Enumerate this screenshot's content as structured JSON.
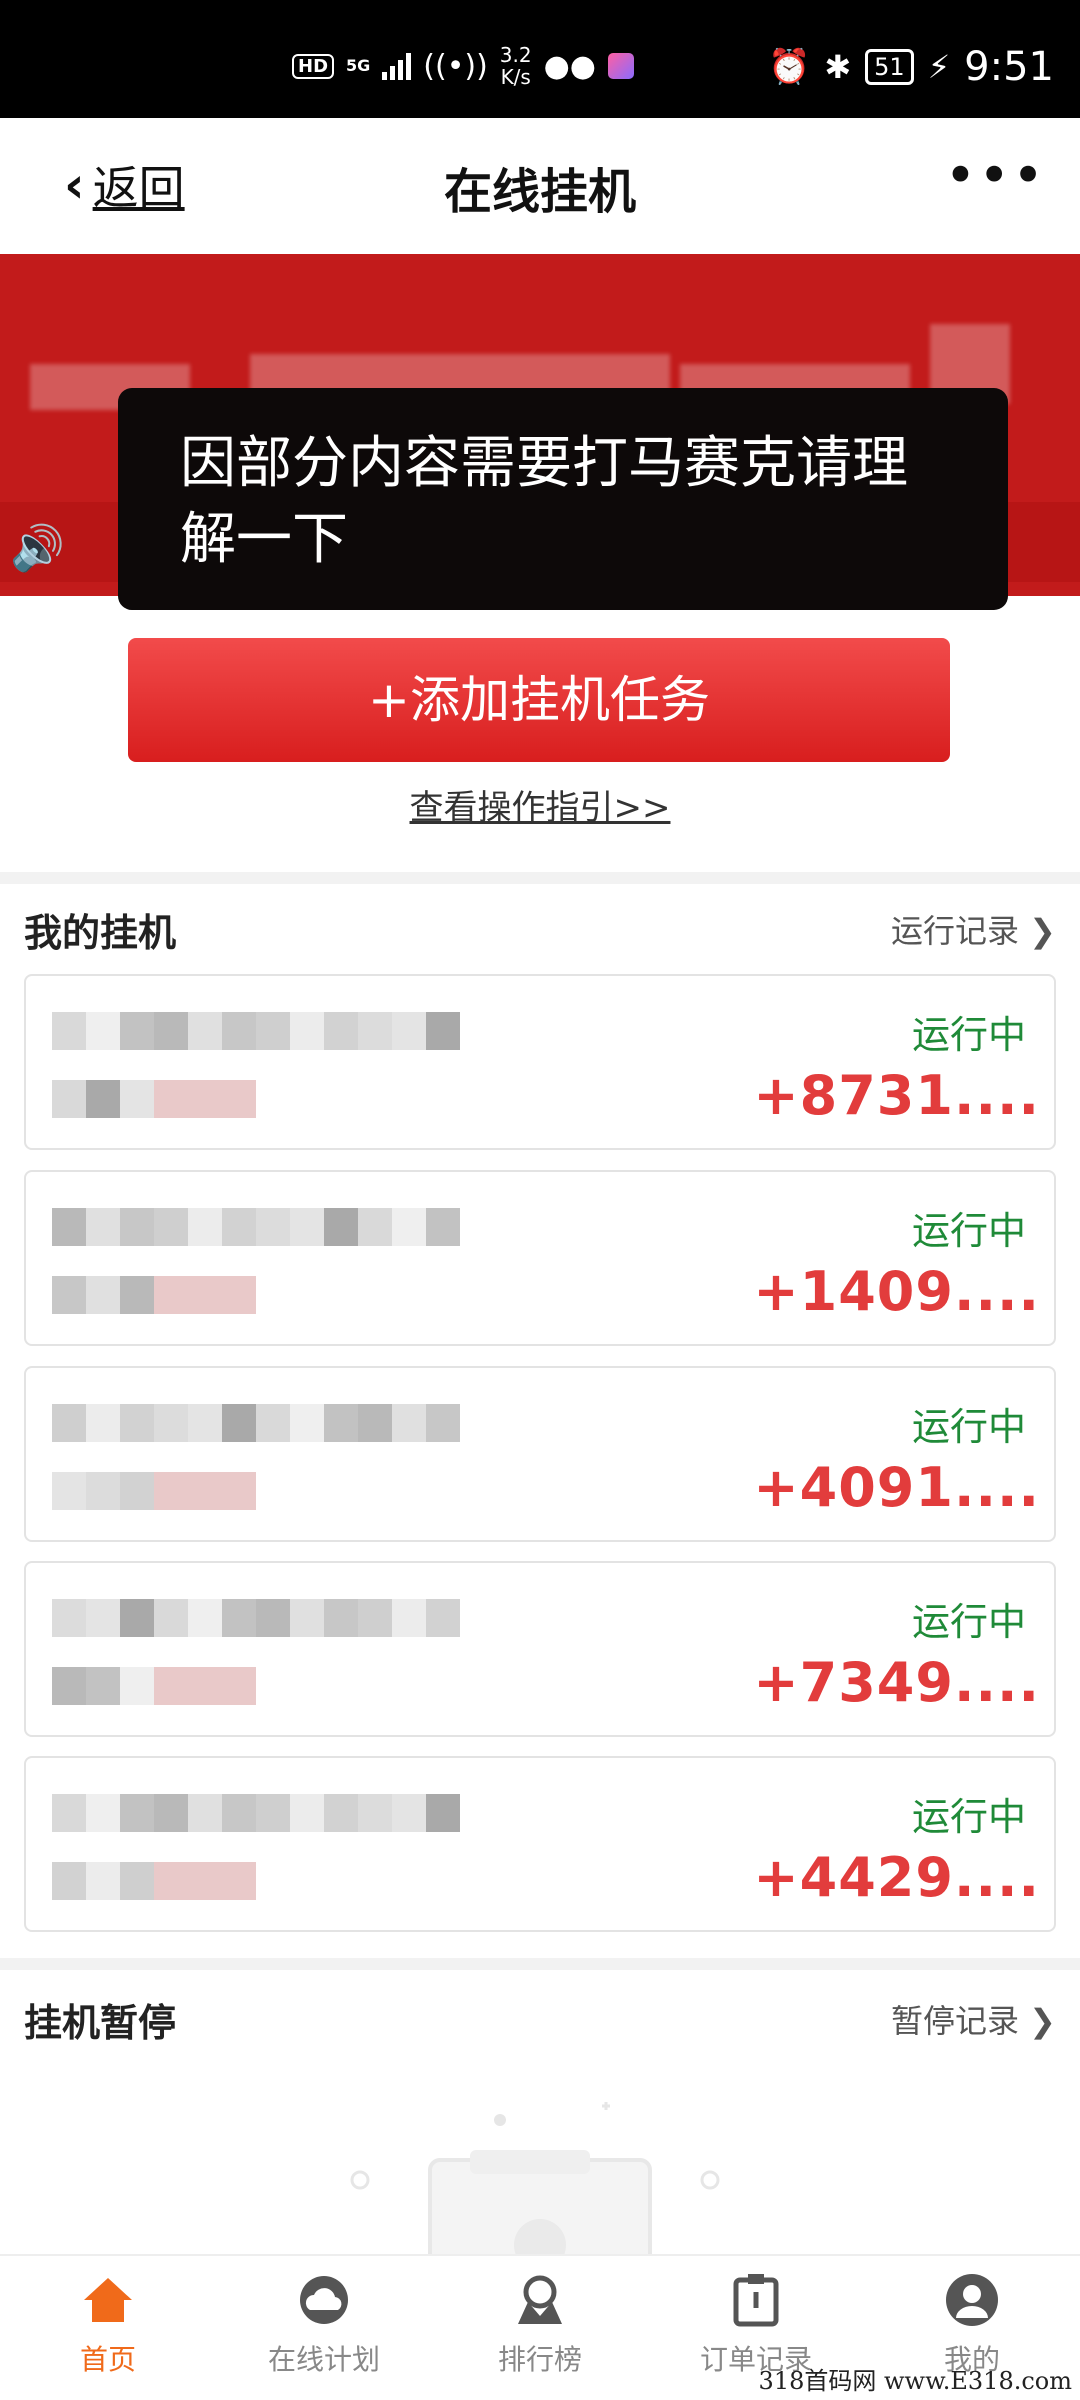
{
  "status_bar": {
    "hd": "HD",
    "network": "5G",
    "speed_value": "3.2",
    "speed_unit": "K/s",
    "battery": "51",
    "time": "9:51"
  },
  "header": {
    "back_label": "返回",
    "title": "在线挂机",
    "more": "•••"
  },
  "notice_text": "因部分内容需要打马赛克请理解一下",
  "add_button_label": "+添加挂机任务",
  "guide_link": "查看操作指引>>",
  "my_section": {
    "title": "我的挂机",
    "link": "运行记录 ❯"
  },
  "cards": [
    {
      "status": "运行中",
      "amount": "+8731...."
    },
    {
      "status": "运行中",
      "amount": "+1409...."
    },
    {
      "status": "运行中",
      "amount": "+4091...."
    },
    {
      "status": "运行中",
      "amount": "+7349...."
    },
    {
      "status": "运行中",
      "amount": "+4429...."
    }
  ],
  "paused_section": {
    "title": "挂机暂停",
    "link": "暂停记录 ❯"
  },
  "nav": [
    {
      "label": "首页",
      "icon": "home-icon",
      "active": true
    },
    {
      "label": "在线计划",
      "icon": "cloud-icon"
    },
    {
      "label": "排行榜",
      "icon": "ranking-icon"
    },
    {
      "label": "订单记录",
      "icon": "clipboard-icon"
    },
    {
      "label": "我的",
      "icon": "user-icon"
    }
  ],
  "watermark": "318首码网 www.E318.com",
  "colors": {
    "brand_red": "#d81e1e",
    "running_green": "#1f8a38",
    "amount_red": "#e23c3c",
    "active_orange": "#f06a1a"
  }
}
